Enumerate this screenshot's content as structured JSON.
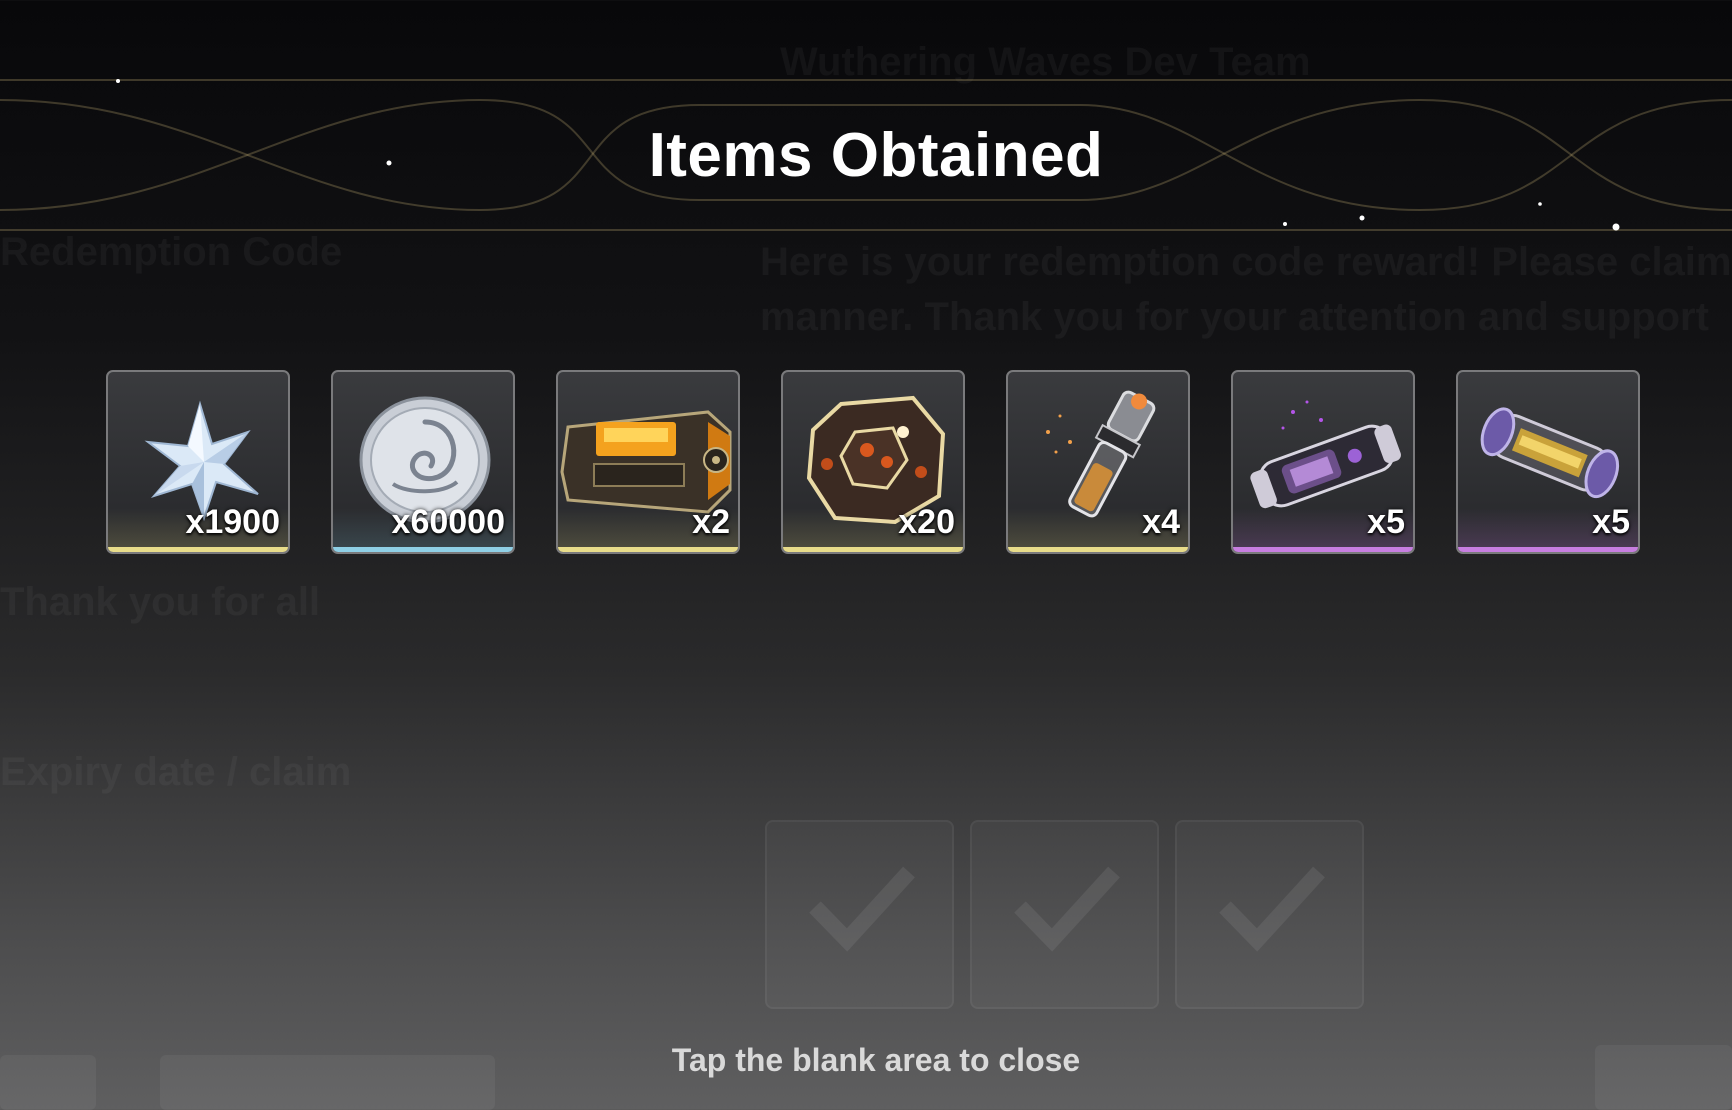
{
  "header": {
    "title": "Items Obtained"
  },
  "items": [
    {
      "name": "Astrite",
      "quantity": "x1900",
      "rarity_color": "#e8dc8a",
      "icon": "star-crystal-icon"
    },
    {
      "name": "Shell Credit",
      "quantity": "x60000",
      "rarity_color": "#8fd0e6",
      "icon": "shell-coin-icon"
    },
    {
      "name": "Energy Core Crate",
      "quantity": "x2",
      "rarity_color": "#e8dc8a",
      "icon": "crate-icon"
    },
    {
      "name": "Supply Pack",
      "quantity": "x20",
      "rarity_color": "#e8dc8a",
      "icon": "polyhedron-pack-icon"
    },
    {
      "name": "Potion Vial",
      "quantity": "x4",
      "rarity_color": "#e8dc8a",
      "icon": "vial-icon"
    },
    {
      "name": "Purple Capsule",
      "quantity": "x5",
      "rarity_color": "#c77ee0",
      "icon": "purple-capsule-icon"
    },
    {
      "name": "Resonance Tube",
      "quantity": "x5",
      "rarity_color": "#c77ee0",
      "icon": "energy-tube-icon"
    }
  ],
  "footer": {
    "hint": "Tap the blank area to close"
  }
}
